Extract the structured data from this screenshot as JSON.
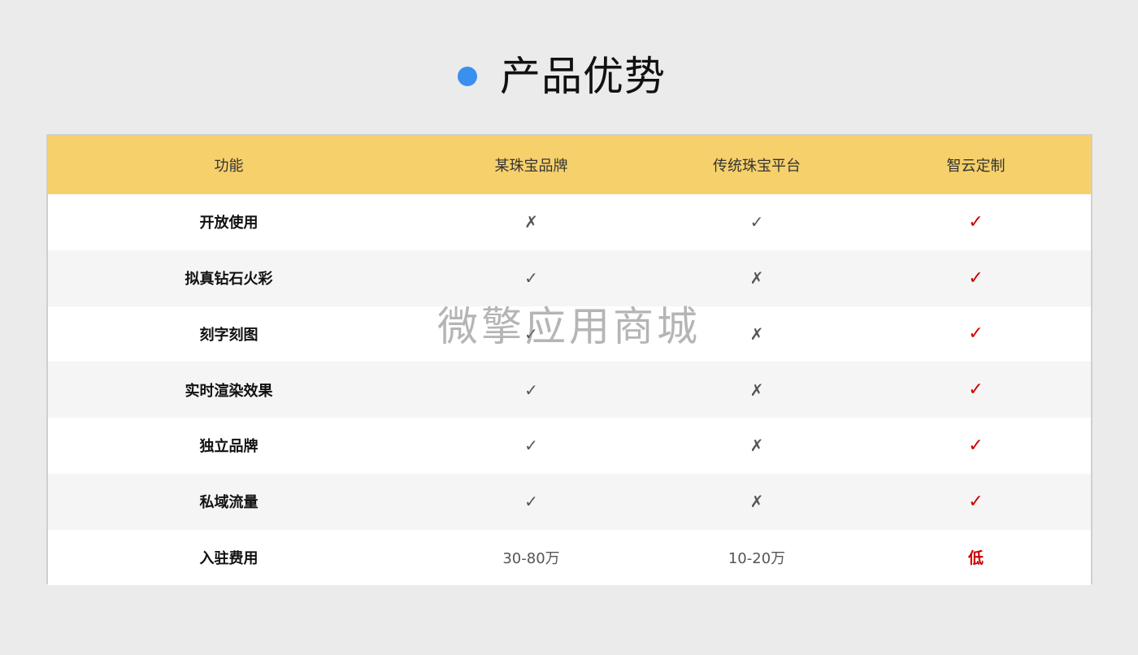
{
  "page_title": "产品优势",
  "title_dot_color": "#3b8fef",
  "header_color": "#f6d06a",
  "accent_red": "#cc0000",
  "table": {
    "columns": [
      "功能",
      "某珠宝品牌",
      "传统珠宝平台",
      "智云定制"
    ],
    "rows": [
      {
        "feature": "开放使用",
        "a": "✗",
        "b": "✓",
        "c": "✓"
      },
      {
        "feature": "拟真钻石火彩",
        "a": "✓",
        "b": "✗",
        "c": "✓"
      },
      {
        "feature": "刻字刻图",
        "a": "✓",
        "b": "✗",
        "c": "✓"
      },
      {
        "feature": "实时渲染效果",
        "a": "✓",
        "b": "✗",
        "c": "✓"
      },
      {
        "feature": "独立品牌",
        "a": "✓",
        "b": "✗",
        "c": "✓"
      },
      {
        "feature": "私域流量",
        "a": "✓",
        "b": "✗",
        "c": "✓"
      },
      {
        "feature": "入驻费用",
        "a": "30-80万",
        "b": "10-20万",
        "c": "低"
      }
    ]
  },
  "watermark": "微擎应用商城"
}
